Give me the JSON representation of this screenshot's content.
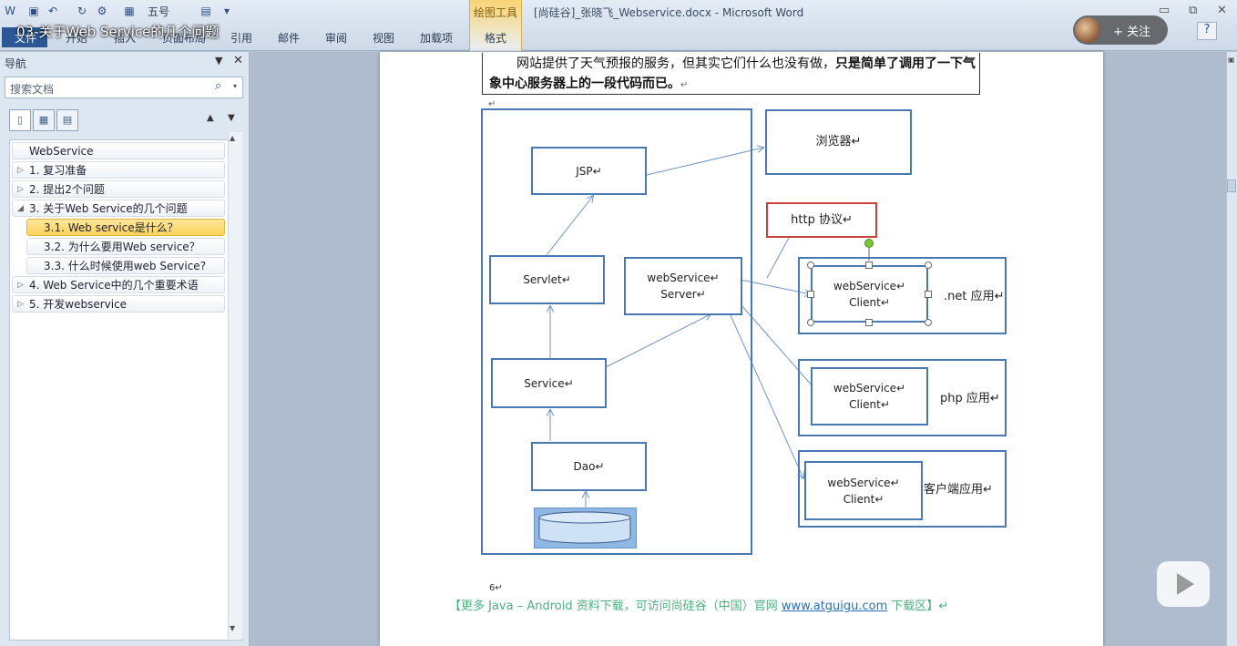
{
  "titlebar": {
    "doc_title": "[尚硅谷]_张晓飞_Webservice.docx - Microsoft Word",
    "context_tab_group": "绘图工具",
    "font_size_value": "五号"
  },
  "ribbon": {
    "tabs": [
      "文件",
      "开始",
      "插入",
      "页面布局",
      "引用",
      "邮件",
      "审阅",
      "视图",
      "加载项",
      "格式"
    ]
  },
  "video": {
    "title": "03-关于Web Service的几个问题",
    "follow_label": "+ 关注"
  },
  "nav": {
    "title": "导航",
    "search_placeholder": "搜索文档",
    "items": [
      {
        "label": "WebService",
        "level": 0,
        "tri": ""
      },
      {
        "label": "1. 复习准备",
        "level": 1,
        "tri": "▷"
      },
      {
        "label": "2.  提出2个问题",
        "level": 1,
        "tri": "▷"
      },
      {
        "label": "3. 关于Web Service的几个问题",
        "level": 1,
        "tri": "◢"
      },
      {
        "label": "3.1. Web service是什么？",
        "level": 2,
        "tri": "",
        "active": true
      },
      {
        "label": "3.2. 为什么要用Web service？",
        "level": 2,
        "tri": ""
      },
      {
        "label": "3.3. 什么时候使用web Service?",
        "level": 2,
        "tri": ""
      },
      {
        "label": "4. Web Service中的几个重要术语",
        "level": 1,
        "tri": "▷"
      },
      {
        "label": "5. 开发webservice",
        "level": 1,
        "tri": "▷"
      }
    ]
  },
  "document": {
    "para_normal": "网站提供了天气预报的服务，但其实它们什么也没有做，",
    "para_bold": "只是简单了调用了一下气象中心服务器上的一段代码而已。",
    "para_mark": "↵",
    "page_number": "6↵",
    "footer_prefix": "【更多 Java – Android 资料下载，可访问尚硅谷（中国）官网 ",
    "footer_link": "www.atguigu.com",
    "footer_suffix": " 下载区】↵"
  },
  "diagram": {
    "jsp": "JSP↵",
    "browser": "浏览器↵",
    "http": "http 协议↵",
    "servlet": "Servlet↵",
    "ws_server_1": "webService↵",
    "ws_server_2": "Server↵",
    "service": "Service↵",
    "dao": "Dao↵",
    "client_1": "webService↵",
    "client_2": "Client↵",
    "net_app": ".net 应用↵",
    "php_app": "php 应用↵",
    "client_app": "客户端应用↵"
  },
  "colors": {
    "diagram_blue": "#4a78b3",
    "http_red": "#c9413d",
    "footer_green": "#4daf82",
    "nav_active": "#fcd25c"
  }
}
